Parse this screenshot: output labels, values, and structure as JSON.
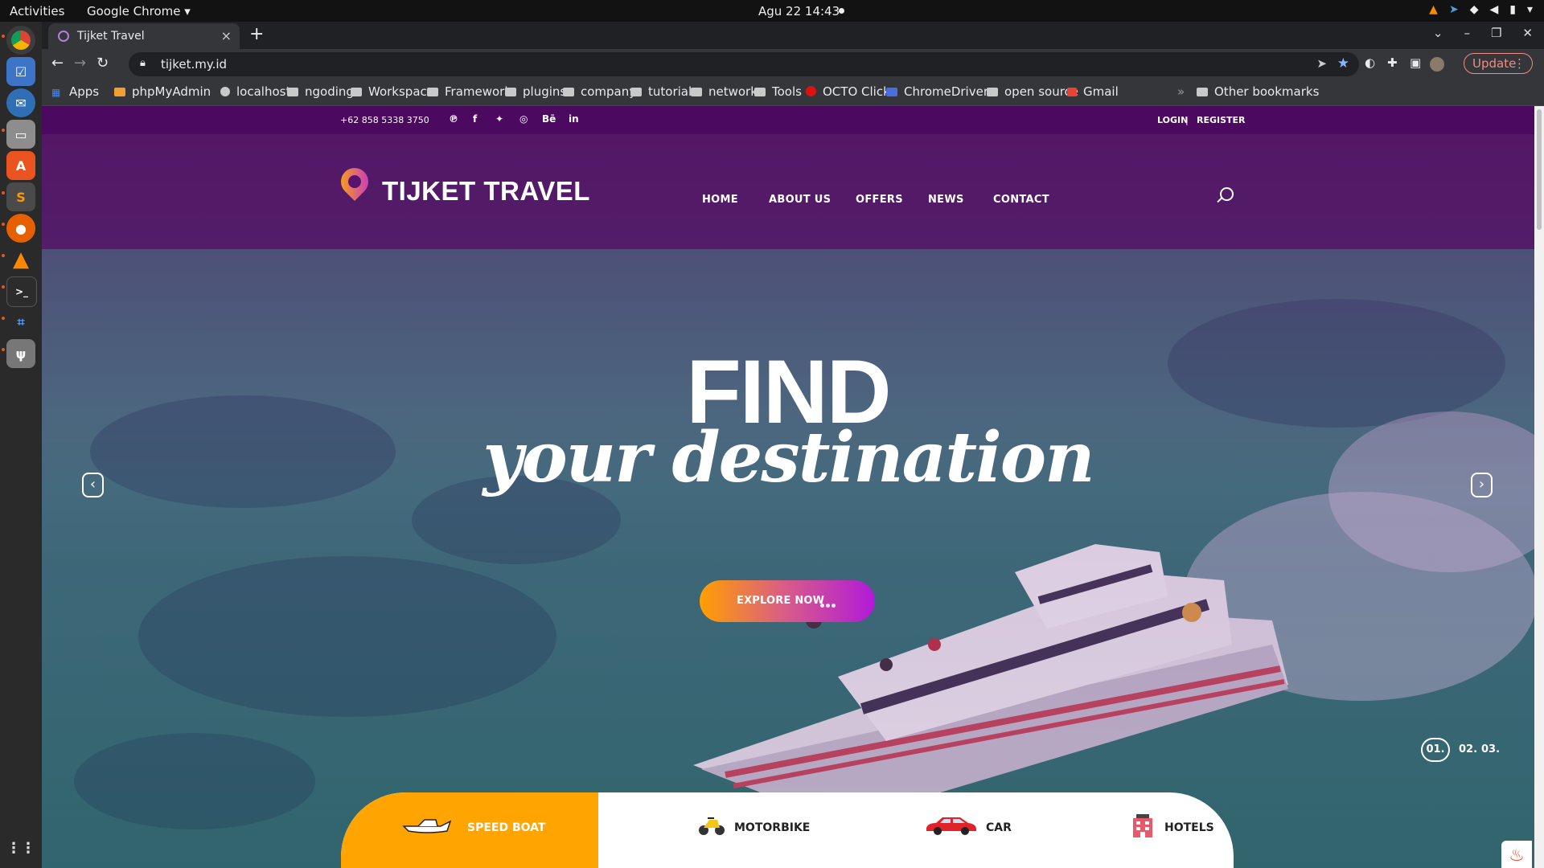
{
  "os": {
    "activities": "Activities",
    "app_name": "Google Chrome",
    "clock": "Agu 22  14:43"
  },
  "browser": {
    "tab_title": "Tijket Travel",
    "url": "tijket.my.id",
    "update_label": "Update",
    "bookmarks": [
      "Apps",
      "phpMyAdmin",
      "localhost",
      "ngoding",
      "Workspace",
      "Framework",
      "plugins",
      "company",
      "tutorial",
      "network",
      "Tools",
      "OCTO Clicks",
      "ChromeDriver...",
      "open source",
      "Gmail"
    ],
    "other_bookmarks": "Other bookmarks"
  },
  "site": {
    "phone": "+62 858 5338 3750",
    "social": [
      "pinterest-icon",
      "facebook-icon",
      "twitter-icon",
      "dribbble-icon",
      "behance-icon",
      "linkedin-icon"
    ],
    "login": "LOGIN",
    "separator": "|",
    "register": "REGISTER",
    "logo_text": "TIJKET TRAVEL",
    "nav": [
      "HOME",
      "ABOUT US",
      "OFFERS",
      "NEWS",
      "CONTACT"
    ],
    "hero": {
      "line1": "FIND",
      "line2": "your destination",
      "cta": "EXPLORE NOW"
    },
    "slides": {
      "current": "01.",
      "second": "02.",
      "third": "03."
    },
    "booking_tabs": [
      {
        "label": "SPEED BOAT",
        "icon": "speedboat-icon",
        "active": true
      },
      {
        "label": "MOTORBIKE",
        "icon": "motorbike-icon",
        "active": false
      },
      {
        "label": "CAR",
        "icon": "car-icon",
        "active": false
      },
      {
        "label": "HOTELS",
        "icon": "hotel-icon",
        "active": false
      }
    ]
  },
  "colors": {
    "brand_purple": "#4b0a5f",
    "accent_orange": "#ffa400",
    "accent_magenta": "#b01ad8"
  }
}
